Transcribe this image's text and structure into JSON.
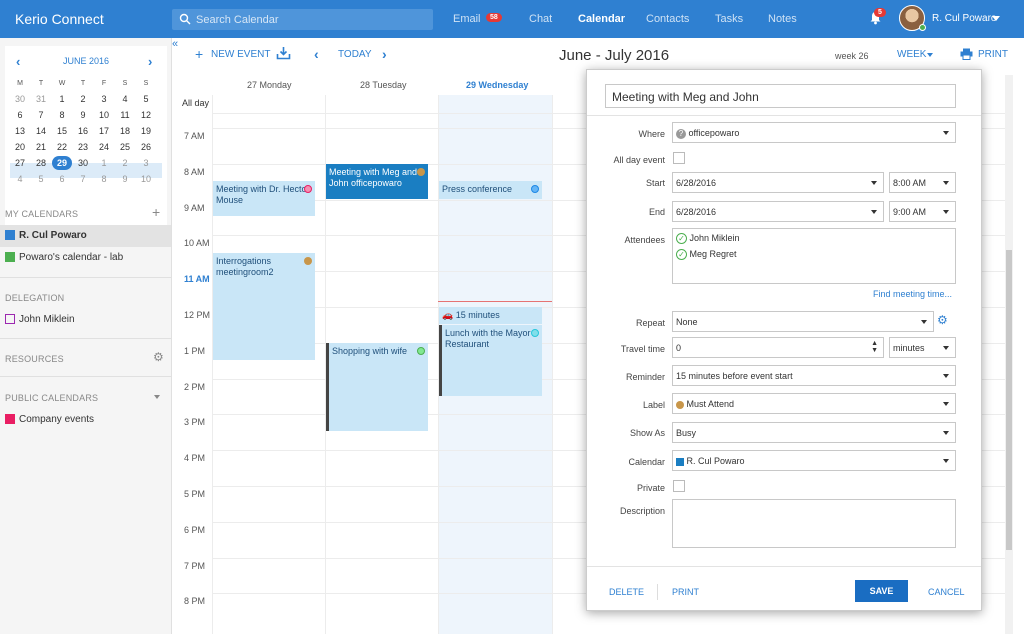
{
  "app": {
    "title": "Kerio Connect"
  },
  "search": {
    "placeholder": "Search Calendar"
  },
  "nav": {
    "email": "Email",
    "email_badge": "58",
    "chat": "Chat",
    "calendar": "Calendar",
    "contacts": "Contacts",
    "tasks": "Tasks",
    "notes": "Notes"
  },
  "notifications": {
    "count": "5"
  },
  "user": {
    "name": "R. Cul Powaro"
  },
  "minical": {
    "month": "JUNE 2016",
    "dow": [
      "M",
      "T",
      "W",
      "T",
      "F",
      "S",
      "S"
    ],
    "weeks": [
      [
        "30",
        "31",
        "1",
        "2",
        "3",
        "4",
        "5"
      ],
      [
        "6",
        "7",
        "8",
        "9",
        "10",
        "11",
        "12"
      ],
      [
        "13",
        "14",
        "15",
        "16",
        "17",
        "18",
        "19"
      ],
      [
        "20",
        "21",
        "22",
        "23",
        "24",
        "25",
        "26"
      ],
      [
        "27",
        "28",
        "29",
        "30",
        "1",
        "2",
        "3"
      ],
      [
        "4",
        "5",
        "6",
        "7",
        "8",
        "9",
        "10"
      ]
    ]
  },
  "sidebar": {
    "my_calendars": "MY CALENDARS",
    "my_cal_1": "R. Cul Powaro",
    "my_cal_2": "Powaro's calendar - lab",
    "delegation": "DELEGATION",
    "delegate_1": "John Miklein",
    "resources": "RESOURCES",
    "public_calendars": "PUBLIC CALENDARS",
    "public_1": "Company events"
  },
  "toolbar": {
    "new_event": "NEW EVENT",
    "today": "TODAY",
    "range_title": "June - July 2016",
    "week_num": "week 26",
    "view": "WEEK",
    "print": "PRINT"
  },
  "grid": {
    "cols": [
      "27 Monday",
      "28 Tuesday",
      "29 Wednesday"
    ],
    "all_day": "All day",
    "hours": [
      "7 AM",
      "8 AM",
      "9 AM",
      "10 AM",
      "11 AM",
      "12 PM",
      "1 PM",
      "2 PM",
      "3 PM",
      "4 PM",
      "5 PM",
      "6 PM",
      "7 PM",
      "8 PM"
    ]
  },
  "events": {
    "e1": "Meeting with Dr. Hector Mouse",
    "e2": "Interrogations meetingroom2",
    "e3": "Meeting with Meg and John officepowaro",
    "e4": "Shopping with wife",
    "e5": "Press conference",
    "e6_travel": "15 minutes",
    "e6": "Lunch with the Mayor Restaurant"
  },
  "dialog": {
    "title_value": "Meeting with Meg and John",
    "where_label": "Where",
    "where_value": "officepowaro",
    "all_day_label": "All day event",
    "start_label": "Start",
    "start_date": "6/28/2016",
    "start_time": "8:00 AM",
    "end_label": "End",
    "end_date": "6/28/2016",
    "end_time": "9:00 AM",
    "attendees_label": "Attendees",
    "attendee_1": "John Miklein",
    "attendee_2": "Meg Regret",
    "find_meeting": "Find meeting time...",
    "repeat_label": "Repeat",
    "repeat_value": "None",
    "travel_label": "Travel time",
    "travel_value": "0",
    "travel_unit": "minutes",
    "reminder_label": "Reminder",
    "reminder_value": "15 minutes before event start",
    "label_label": "Label",
    "label_value": "Must Attend",
    "show_as_label": "Show As",
    "show_as_value": "Busy",
    "calendar_label": "Calendar",
    "calendar_value": "R. Cul Powaro",
    "private_label": "Private",
    "description_label": "Description",
    "delete": "DELETE",
    "print": "PRINT",
    "save": "SAVE",
    "cancel": "CANCEL"
  },
  "colors": {
    "accent": "#2f80d1",
    "event_light": "#c9e6f7",
    "event_dark": "#1a7ec2",
    "must_attend": "#c8964a"
  }
}
